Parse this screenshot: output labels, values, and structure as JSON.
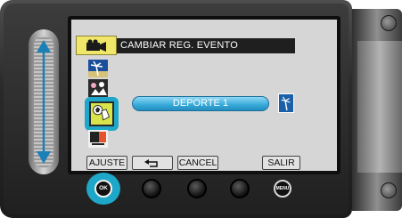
{
  "menu": {
    "title": "CAMBIAR REG. EVENTO",
    "selected_value": "DEPORTE 1"
  },
  "softkeys": {
    "ajuste": "AJUSTE",
    "back_symbol": "⮌",
    "cancel": "CANCEL",
    "salir": "SALIR"
  },
  "buttons": {
    "ok": "OK",
    "menu": "MENU"
  },
  "icons": {
    "mode_tab": "video-camera-icon",
    "event_options": [
      "beach-event-icon",
      "party-event-icon",
      "sports-event-icon",
      "flag-event-icon"
    ],
    "selected_event": "sports-event-icon",
    "preview_icon": "beach-event-icon",
    "slider_arrows": "up-down-arrow-icon"
  },
  "colors": {
    "highlight": "#1ea7c8",
    "field_blue": "#36a9d8",
    "tab_yellow": "#f0e66a"
  }
}
